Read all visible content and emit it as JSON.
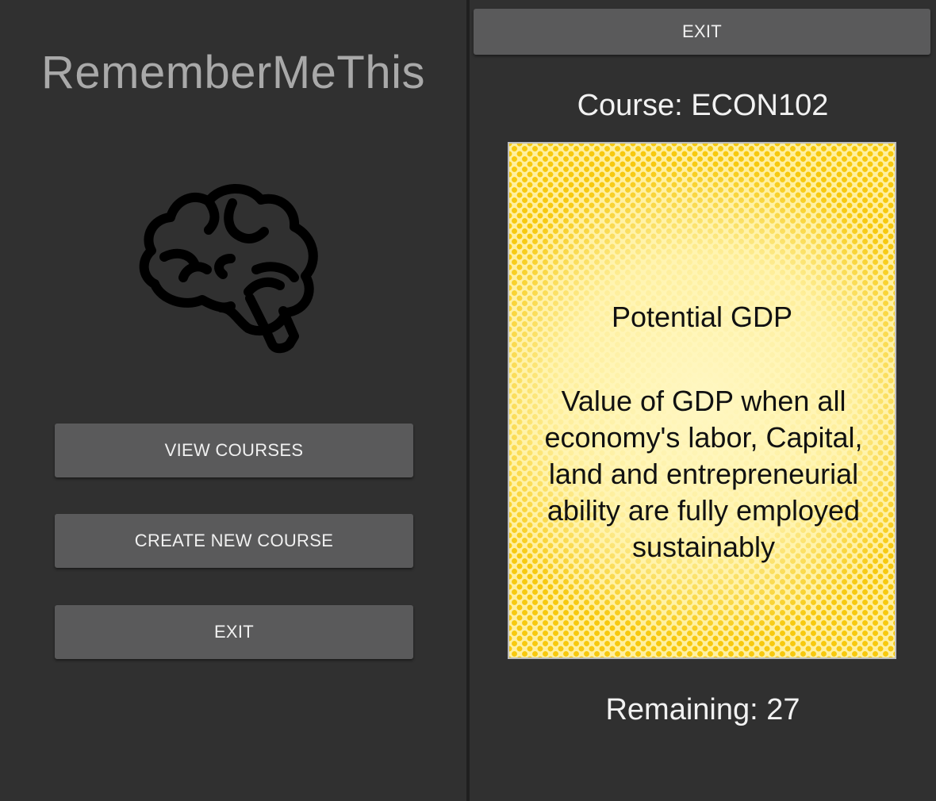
{
  "left_screen": {
    "app_title": "RememberMeThis",
    "logo_icon": "brain-icon",
    "buttons": {
      "view_courses": "VIEW COURSES",
      "create_new_course": "CREATE NEW COURSE",
      "exit": "EXIT"
    }
  },
  "right_screen": {
    "exit_button": "EXIT",
    "course_label": "Course: ECON102",
    "card": {
      "term": "Potential GDP",
      "definition": "Value of GDP when all economy's labor, Capital, land and entrepreneurial ability are fully employed sustainably",
      "pattern_color": "#f7c90f",
      "base_color": "#fff0a0"
    },
    "remaining_label": "Remaining: 27"
  },
  "colors": {
    "background": "#303030",
    "button": "#5a5a5b",
    "button_text": "#f0f0f0",
    "title_text": "#a9a9a9"
  }
}
